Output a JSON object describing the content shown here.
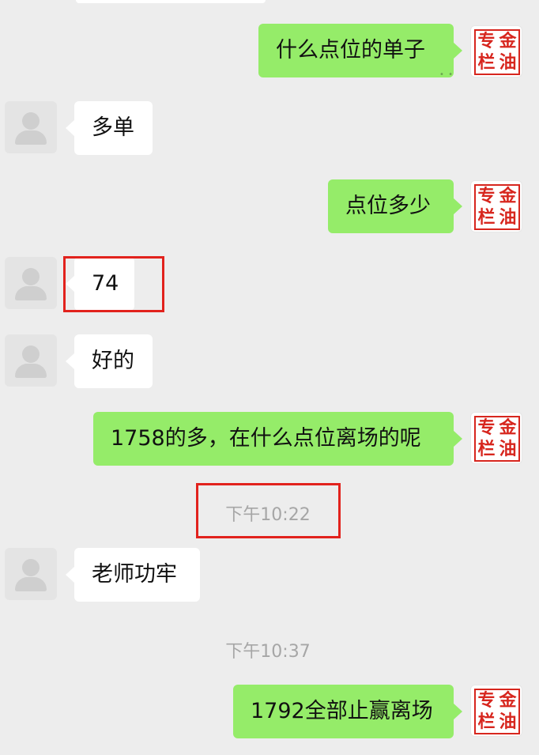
{
  "contact_avatar_icon": "person-placeholder-icon",
  "my_avatar_stamp": [
    "专",
    "金",
    "栏",
    "油"
  ],
  "colors": {
    "sent_bubble": "#95ec69",
    "received_bubble": "#ffffff",
    "background": "#ededed",
    "highlight_box": "#e2221d",
    "stamp": "#d7261e"
  },
  "messages": [
    {
      "side": "right",
      "text": "什么点位的单子"
    },
    {
      "side": "left",
      "text": "多单"
    },
    {
      "side": "right",
      "text": "点位多少"
    },
    {
      "side": "left",
      "text": "74"
    },
    {
      "side": "left",
      "text": "好的"
    },
    {
      "side": "right",
      "text": "1758的多，在什么点位离场的呢"
    },
    {
      "side": "left",
      "text": "老师功牢"
    },
    {
      "side": "right",
      "text": "1792全部止赢离场"
    }
  ],
  "timestamps": [
    "下午10:22",
    "下午10:37"
  ]
}
